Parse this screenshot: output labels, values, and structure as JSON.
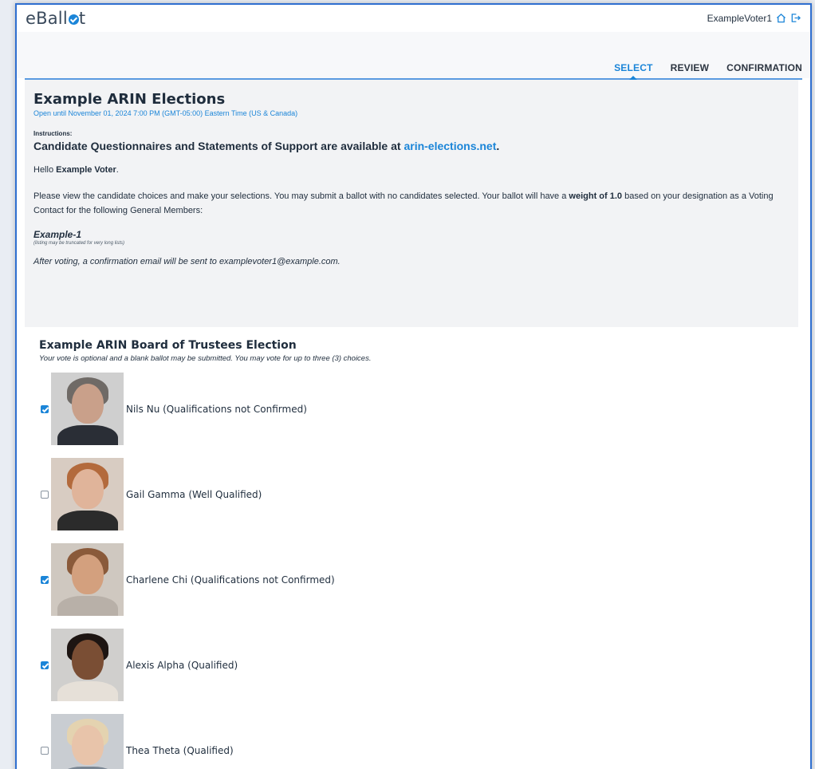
{
  "header": {
    "logo_text": "eBall",
    "username": "ExampleVoter1"
  },
  "steps": [
    {
      "label": "SELECT",
      "active": true
    },
    {
      "label": "REVIEW",
      "active": false
    },
    {
      "label": "CONFIRMATION",
      "active": false
    }
  ],
  "info": {
    "title": "Example ARIN Elections",
    "open_until": "Open until November 01, 2024 7:00 PM (GMT-05:00) Eastern Time (US & Canada)",
    "instructions_label": "Instructions:",
    "instructions_text": "Candidate Questionnaires and Statements of Support are available at ",
    "instructions_link": "arin-elections.net",
    "instructions_end": ".",
    "hello_prefix": "Hello ",
    "hello_name": "Example Voter",
    "hello_suffix": ".",
    "desc_1": "Please view the candidate choices and make your selections. You may submit a ballot with no candidates selected. Your ballot will have a ",
    "desc_weight": "weight of 1.0",
    "desc_2": " based on your designation as a Voting Contact for the following General Members:",
    "member": "Example-1",
    "truncation_note": "(listing may be truncated for very long lists)",
    "after_voting": "After voting, a confirmation email will be sent to examplevoter1@example.com."
  },
  "election": {
    "title": "Example ARIN Board of Trustees Election",
    "subtitle": "Your vote is optional and a blank ballot may be submitted. You may vote for up to three (3) choices.",
    "candidates": [
      {
        "name": "Nils Nu (Qualifications not Confirmed)",
        "checked": true,
        "skin": "#c9a08a",
        "hair": "#6f6a66",
        "body": "#2a2e36",
        "bg": "#cfcfcf"
      },
      {
        "name": "Gail Gamma (Well Qualified)",
        "checked": false,
        "skin": "#e0b49a",
        "hair": "#b36a3c",
        "body": "#2b2b2b",
        "bg": "#d8ccc2"
      },
      {
        "name": "Charlene Chi (Qualifications not Confirmed)",
        "checked": true,
        "skin": "#d3a07e",
        "hair": "#8a5a3a",
        "body": "#b8b0a8",
        "bg": "#cfc8c0"
      },
      {
        "name": "Alexis Alpha (Qualified)",
        "checked": true,
        "skin": "#7a4e34",
        "hair": "#1d1512",
        "body": "#e6e0d8",
        "bg": "#d0cfcd"
      },
      {
        "name": "Thea Theta (Qualified)",
        "checked": false,
        "skin": "#e8c4aa",
        "hair": "#e4d3b0",
        "body": "#7b8794",
        "bg": "#c9cdd2"
      }
    ]
  }
}
